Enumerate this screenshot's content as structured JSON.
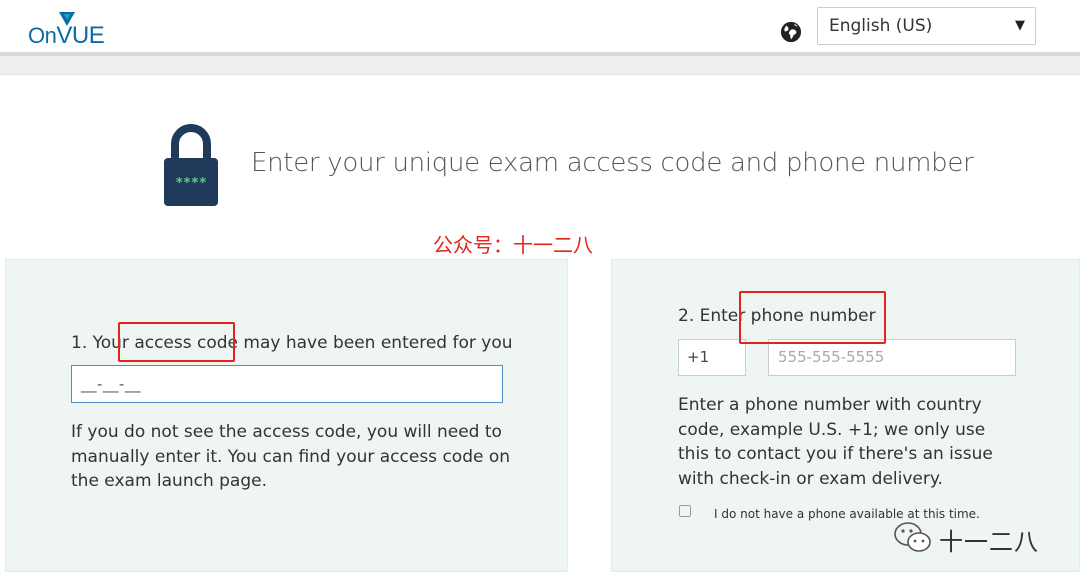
{
  "header": {
    "logo_text_on": "On",
    "logo_text_vue": "VUE",
    "language": "English (US)"
  },
  "icons": {
    "globe": "globe-icon",
    "lock": "padlock-icon",
    "caret": "chevron-down-icon",
    "wechat": "wechat-icon"
  },
  "main": {
    "title": "Enter your unique exam access code and phone number",
    "lock_code": "****",
    "watermark": "公众号：十一二八"
  },
  "step1": {
    "label": "1. Your access code may have been entered for you",
    "code_value": "__-__-__",
    "help": "If you do not see the access code, you will need to manually enter it. You can find your access code on the exam launch page."
  },
  "step2": {
    "label": "2. Enter phone number",
    "country_code": "+1",
    "phone_placeholder": "555-555-5555",
    "help": "Enter a phone number with country code, example U.S. +1; we only use this to contact you if there's an issue with check-in or exam delivery.",
    "no_phone_label": "I do not have a phone available at this time."
  },
  "footer": {
    "wechat_text": "十一二八"
  },
  "colors": {
    "brand_blue": "#0d6aa8",
    "panel_bg": "#eef5f3",
    "highlight_red": "#e4231d",
    "lock_body": "#1f3a5a",
    "lock_code": "#5fd17a"
  }
}
